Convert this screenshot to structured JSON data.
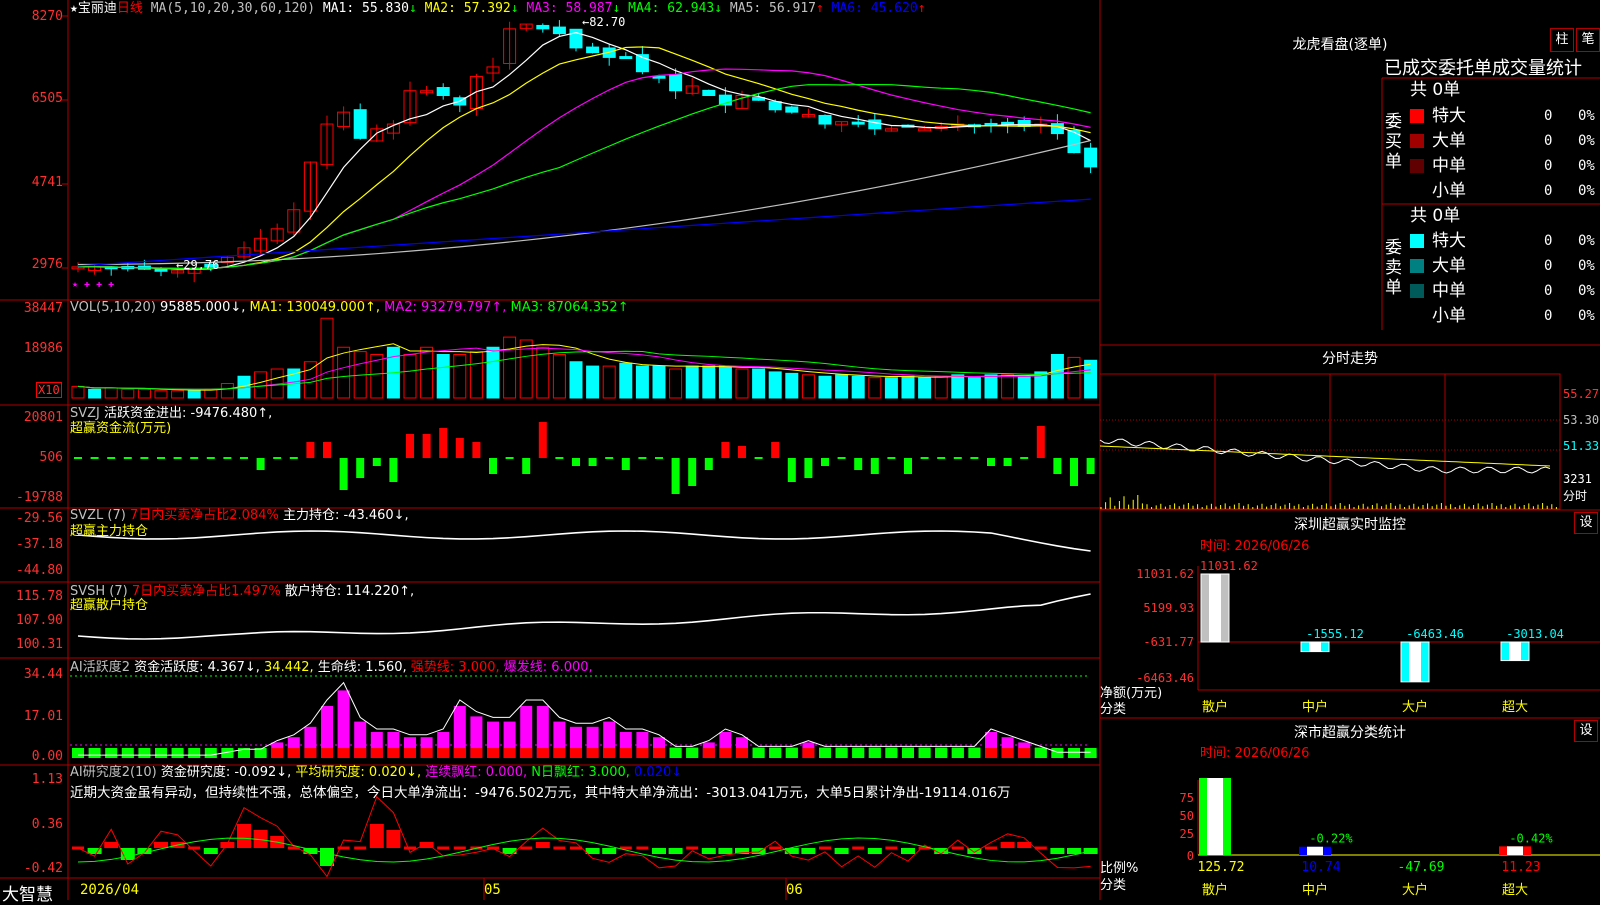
{
  "main": {
    "header": {
      "star": "★",
      "stock_name": "宝丽迪",
      "period": "日线",
      "ma_label": "MA(5,10,20,30,60,120)",
      "ma": [
        {
          "name": "MA1:",
          "value": "55.830",
          "arrow": "↓",
          "color": "#ffffff"
        },
        {
          "name": "MA2:",
          "value": "57.392",
          "arrow": "↓",
          "color": "#ffff00"
        },
        {
          "name": "MA3:",
          "value": "58.987",
          "arrow": "↓",
          "color": "#ff00ff"
        },
        {
          "name": "MA4:",
          "value": "62.943",
          "arrow": "↓",
          "color": "#00ff00"
        },
        {
          "name": "MA5:",
          "value": "56.917",
          "arrow": "↑",
          "color": "#c0c0c0"
        },
        {
          "name": "MA6:",
          "value": "45.620",
          "arrow": "↑",
          "color": "#0000ff"
        }
      ]
    },
    "y_labels": [
      "8270",
      "6505",
      "4741",
      "2976"
    ],
    "high_label": "82.70",
    "low_label": "29.76"
  },
  "vol": {
    "header": [
      {
        "text": "VOL(5,10,20)",
        "color": "#c0c0c0"
      },
      {
        "text": "95885.000↓,",
        "color": "#ffffff"
      },
      {
        "text": "MA1: 130049.000↑,",
        "color": "#ffff00"
      },
      {
        "text": "MA2: 93279.797↑,",
        "color": "#ff00ff"
      },
      {
        "text": "MA3: 87064.352↑",
        "color": "#00ff00"
      }
    ],
    "y_labels": [
      "38447",
      "18986"
    ],
    "unit": "X10"
  },
  "svzj": {
    "header": [
      {
        "text": "SVZJ",
        "color": "#c0c0c0"
      },
      {
        "text": "活跃资金进出: -9476.480↑,",
        "color": "#ffffff"
      }
    ],
    "subtitle": "超赢资金流(万元)",
    "y_labels": [
      "20801",
      "506",
      "-19788"
    ]
  },
  "svzl": {
    "header": [
      {
        "text": "SVZL (7)",
        "color": "#c0c0c0"
      },
      {
        "text": "7日内买卖净占比2.084%",
        "color": "#ff0000"
      },
      {
        "text": "主力持仓: -43.460↓,",
        "color": "#ffffff"
      }
    ],
    "subtitle": "超赢主力持仓",
    "y_labels": [
      "-29.56",
      "-37.18",
      "-44.80"
    ]
  },
  "svsh": {
    "header": [
      {
        "text": "SVSH (7)",
        "color": "#c0c0c0"
      },
      {
        "text": "7日内买卖净占比1.497%",
        "color": "#ff0000"
      },
      {
        "text": "散户持仓: 114.220↑,",
        "color": "#ffffff"
      }
    ],
    "subtitle": "超赢散户持仓",
    "y_labels": [
      "115.78",
      "107.90",
      "100.31"
    ]
  },
  "ai_active": {
    "header": [
      {
        "text": "AI活跃度2",
        "color": "#c0c0c0"
      },
      {
        "text": "资金活跃度: 4.367↓,",
        "color": "#ffffff"
      },
      {
        "text": "34.442,",
        "color": "#ffff00"
      },
      {
        "text": "生命线: 1.560,",
        "color": "#ffffff"
      },
      {
        "text": "强势线: 3.000,",
        "color": "#ff0000"
      },
      {
        "text": "爆发线: 6.000,",
        "color": "#ff00ff"
      }
    ],
    "y_labels": [
      "34.44",
      "17.01",
      "0.00"
    ]
  },
  "ai_research": {
    "header": [
      {
        "text": "AI研究度2(10)",
        "color": "#c0c0c0"
      },
      {
        "text": "资金研究度: -0.092↓,",
        "color": "#ffffff"
      },
      {
        "text": "平均研究度: 0.020↓,",
        "color": "#ffff00"
      },
      {
        "text": "连续飘红: 0.000,",
        "color": "#ff00ff"
      },
      {
        "text": "N日飘红: 3.000,",
        "color": "#00ff00"
      },
      {
        "text": "0.020↓",
        "color": "#0000ff"
      }
    ],
    "summary": "近期大资金虽有异动，但持续性不强，总体偏空，今日大单净流出：-9476.502万元，其中特大单净流出：-3013.041万元，大单5日累计净出-19114.016万",
    "y_labels": [
      "1.13",
      "0.36",
      "-0.42"
    ]
  },
  "bottom": {
    "brand": "大智慧",
    "date": "2026/04",
    "months": [
      "05",
      "06"
    ]
  },
  "right": {
    "longhu": {
      "title": "龙虎看盘(逐单)",
      "btn1": "柱",
      "btn2": "笔",
      "subtitle": "已成交委托单成交量统计",
      "buy": {
        "side_label": "委买单",
        "total": "共 0单",
        "rows": [
          {
            "name": "特大",
            "count": "0",
            "pct": "0%",
            "color": "#ff0000"
          },
          {
            "name": "大单",
            "count": "0",
            "pct": "0%",
            "color": "#a00000"
          },
          {
            "name": "中单",
            "count": "0",
            "pct": "0%",
            "color": "#600000"
          },
          {
            "name": "小单",
            "count": "0",
            "pct": "0%",
            "color": "#000000"
          }
        ]
      },
      "sell": {
        "side_label": "委卖单",
        "total": "共 0单",
        "rows": [
          {
            "name": "特大",
            "count": "0",
            "pct": "0%",
            "color": "#00ffff"
          },
          {
            "name": "大单",
            "count": "0",
            "pct": "0%",
            "color": "#008080"
          },
          {
            "name": "中单",
            "count": "0",
            "pct": "0%",
            "color": "#005a5a"
          },
          {
            "name": "小单",
            "count": "0",
            "pct": "0%",
            "color": "#000000"
          }
        ]
      }
    },
    "intraday": {
      "title": "分时走势",
      "y_labels": [
        "55.27",
        "53.30",
        "51.33"
      ],
      "vol_label": "3231",
      "unit": "分时"
    },
    "monitor": {
      "title": "深圳超赢实时监控",
      "set": "设",
      "time": "时间: 2026/06/26",
      "top_value": "11031.62",
      "y_labels": [
        "11031.62",
        "5199.93",
        "-631.77",
        "-6463.46"
      ],
      "y_axis_label": "净额(万元)",
      "x_axis_label": "分类",
      "bars": [
        {
          "name": "散户",
          "value": 11031.62,
          "label": "11031.62"
        },
        {
          "name": "中户",
          "value": -1555.12,
          "label": "-1555.12"
        },
        {
          "name": "大户",
          "value": -6463.46,
          "label": "-6463.46"
        },
        {
          "name": "超大",
          "value": -3013.04,
          "label": "-3013.04"
        }
      ]
    },
    "classify": {
      "title": "深市超赢分类统计",
      "set": "设",
      "time": "时间: 2026/06/26",
      "y_labels": [
        "75",
        "50",
        "25",
        "0"
      ],
      "y_axis_label": "比例%",
      "x_axis_label": "分类",
      "bars": [
        {
          "name": "散户",
          "value": 125.72,
          "label": "125.72"
        },
        {
          "name": "中户",
          "value": 10.74,
          "label": "10.74",
          "top": "-0.22%"
        },
        {
          "name": "大户",
          "value": -47.69,
          "label": "-47.69"
        },
        {
          "name": "超大",
          "value": 11.23,
          "label": "11.23",
          "top": "-0.42%"
        }
      ]
    }
  }
}
